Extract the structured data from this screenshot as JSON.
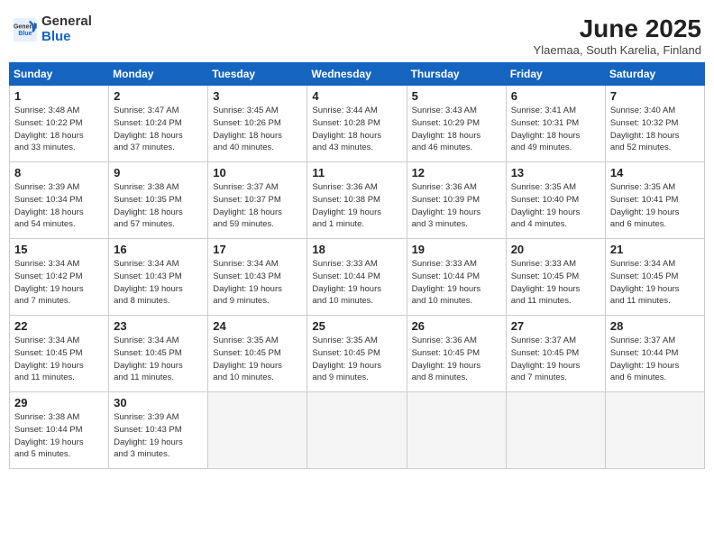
{
  "logo": {
    "general": "General",
    "blue": "Blue"
  },
  "title": "June 2025",
  "subtitle": "Ylaemaa, South Karelia, Finland",
  "headers": [
    "Sunday",
    "Monday",
    "Tuesday",
    "Wednesday",
    "Thursday",
    "Friday",
    "Saturday"
  ],
  "weeks": [
    [
      {
        "day": "1",
        "info": "Sunrise: 3:48 AM\nSunset: 10:22 PM\nDaylight: 18 hours\nand 33 minutes."
      },
      {
        "day": "2",
        "info": "Sunrise: 3:47 AM\nSunset: 10:24 PM\nDaylight: 18 hours\nand 37 minutes."
      },
      {
        "day": "3",
        "info": "Sunrise: 3:45 AM\nSunset: 10:26 PM\nDaylight: 18 hours\nand 40 minutes."
      },
      {
        "day": "4",
        "info": "Sunrise: 3:44 AM\nSunset: 10:28 PM\nDaylight: 18 hours\nand 43 minutes."
      },
      {
        "day": "5",
        "info": "Sunrise: 3:43 AM\nSunset: 10:29 PM\nDaylight: 18 hours\nand 46 minutes."
      },
      {
        "day": "6",
        "info": "Sunrise: 3:41 AM\nSunset: 10:31 PM\nDaylight: 18 hours\nand 49 minutes."
      },
      {
        "day": "7",
        "info": "Sunrise: 3:40 AM\nSunset: 10:32 PM\nDaylight: 18 hours\nand 52 minutes."
      }
    ],
    [
      {
        "day": "8",
        "info": "Sunrise: 3:39 AM\nSunset: 10:34 PM\nDaylight: 18 hours\nand 54 minutes."
      },
      {
        "day": "9",
        "info": "Sunrise: 3:38 AM\nSunset: 10:35 PM\nDaylight: 18 hours\nand 57 minutes."
      },
      {
        "day": "10",
        "info": "Sunrise: 3:37 AM\nSunset: 10:37 PM\nDaylight: 18 hours\nand 59 minutes."
      },
      {
        "day": "11",
        "info": "Sunrise: 3:36 AM\nSunset: 10:38 PM\nDaylight: 19 hours\nand 1 minute."
      },
      {
        "day": "12",
        "info": "Sunrise: 3:36 AM\nSunset: 10:39 PM\nDaylight: 19 hours\nand 3 minutes."
      },
      {
        "day": "13",
        "info": "Sunrise: 3:35 AM\nSunset: 10:40 PM\nDaylight: 19 hours\nand 4 minutes."
      },
      {
        "day": "14",
        "info": "Sunrise: 3:35 AM\nSunset: 10:41 PM\nDaylight: 19 hours\nand 6 minutes."
      }
    ],
    [
      {
        "day": "15",
        "info": "Sunrise: 3:34 AM\nSunset: 10:42 PM\nDaylight: 19 hours\nand 7 minutes."
      },
      {
        "day": "16",
        "info": "Sunrise: 3:34 AM\nSunset: 10:43 PM\nDaylight: 19 hours\nand 8 minutes."
      },
      {
        "day": "17",
        "info": "Sunrise: 3:34 AM\nSunset: 10:43 PM\nDaylight: 19 hours\nand 9 minutes."
      },
      {
        "day": "18",
        "info": "Sunrise: 3:33 AM\nSunset: 10:44 PM\nDaylight: 19 hours\nand 10 minutes."
      },
      {
        "day": "19",
        "info": "Sunrise: 3:33 AM\nSunset: 10:44 PM\nDaylight: 19 hours\nand 10 minutes."
      },
      {
        "day": "20",
        "info": "Sunrise: 3:33 AM\nSunset: 10:45 PM\nDaylight: 19 hours\nand 11 minutes."
      },
      {
        "day": "21",
        "info": "Sunrise: 3:34 AM\nSunset: 10:45 PM\nDaylight: 19 hours\nand 11 minutes."
      }
    ],
    [
      {
        "day": "22",
        "info": "Sunrise: 3:34 AM\nSunset: 10:45 PM\nDaylight: 19 hours\nand 11 minutes."
      },
      {
        "day": "23",
        "info": "Sunrise: 3:34 AM\nSunset: 10:45 PM\nDaylight: 19 hours\nand 11 minutes."
      },
      {
        "day": "24",
        "info": "Sunrise: 3:35 AM\nSunset: 10:45 PM\nDaylight: 19 hours\nand 10 minutes."
      },
      {
        "day": "25",
        "info": "Sunrise: 3:35 AM\nSunset: 10:45 PM\nDaylight: 19 hours\nand 9 minutes."
      },
      {
        "day": "26",
        "info": "Sunrise: 3:36 AM\nSunset: 10:45 PM\nDaylight: 19 hours\nand 8 minutes."
      },
      {
        "day": "27",
        "info": "Sunrise: 3:37 AM\nSunset: 10:45 PM\nDaylight: 19 hours\nand 7 minutes."
      },
      {
        "day": "28",
        "info": "Sunrise: 3:37 AM\nSunset: 10:44 PM\nDaylight: 19 hours\nand 6 minutes."
      }
    ],
    [
      {
        "day": "29",
        "info": "Sunrise: 3:38 AM\nSunset: 10:44 PM\nDaylight: 19 hours\nand 5 minutes."
      },
      {
        "day": "30",
        "info": "Sunrise: 3:39 AM\nSunset: 10:43 PM\nDaylight: 19 hours\nand 3 minutes."
      },
      {
        "day": "",
        "info": ""
      },
      {
        "day": "",
        "info": ""
      },
      {
        "day": "",
        "info": ""
      },
      {
        "day": "",
        "info": ""
      },
      {
        "day": "",
        "info": ""
      }
    ]
  ]
}
